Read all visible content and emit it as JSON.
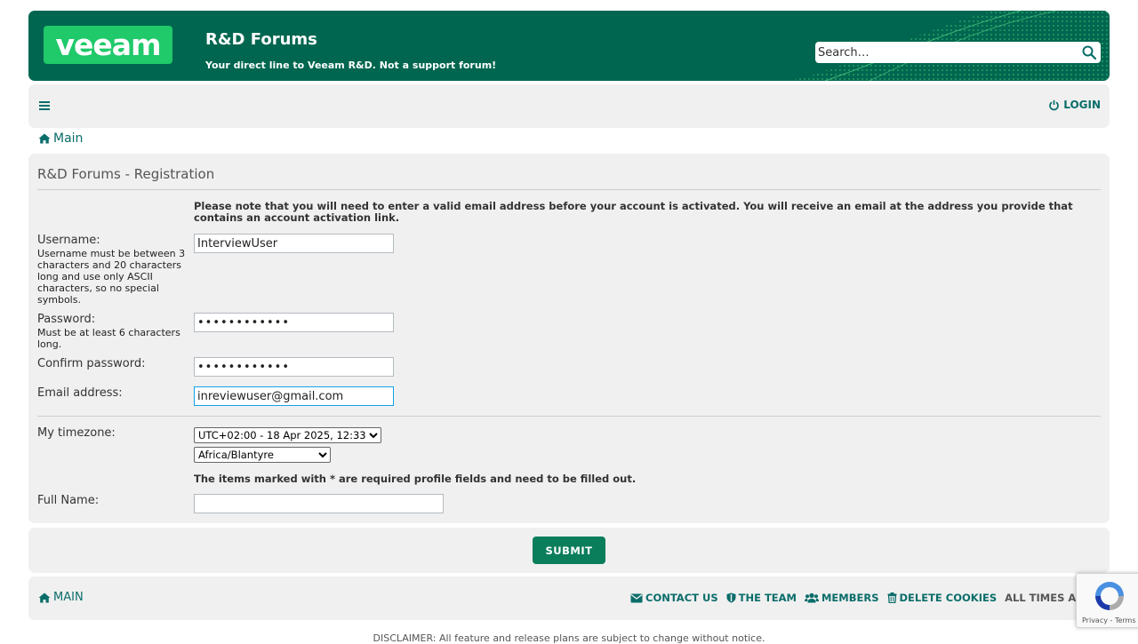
{
  "header": {
    "logo_text": "veeam",
    "site_title": "R&D Forums",
    "site_description": "Your direct line to Veeam R&D. Not a support forum!",
    "search_placeholder": "Search…",
    "search_icon": "search-icon",
    "brand_color": "#00664f",
    "logo_color": "#20c96a"
  },
  "navbar": {
    "menu_icon": "hamburger-icon",
    "login_label": "LOGIN",
    "login_icon": "power-icon"
  },
  "breadcrumb": {
    "home_label": "Main",
    "home_icon": "home-icon"
  },
  "registration": {
    "title": "R&D Forums - Registration",
    "note": "Please note that you will need to enter a valid email address before your account is activated. You will receive an email at the address you provide that contains an account activation link.",
    "fields": {
      "username": {
        "label": "Username:",
        "explain": "Username must be between 3 characters and 20 characters long and use only ASCII characters, so no special symbols.",
        "value": "InterviewUser"
      },
      "password": {
        "label": "Password:",
        "explain": "Must be at least 6 characters long.",
        "value": "••••••••••••"
      },
      "confirm_password": {
        "label": "Confirm password:",
        "value": "••••••••••••"
      },
      "email": {
        "label": "Email address:",
        "value": "inreviewuser@gmail.com"
      },
      "timezone": {
        "label": "My timezone:",
        "offset_selected": "UTC+02:00 - 18 Apr 2025, 12:33",
        "zone_selected": "Africa/Blantyre"
      },
      "required_note": "The items marked with * are required profile fields and need to be filled out.",
      "full_name": {
        "label": "Full Name:",
        "value": ""
      }
    },
    "submit_label": "SUBMIT",
    "submit_color": "#0a7d5b"
  },
  "footer": {
    "main_label": "MAIN",
    "links": [
      {
        "label": "CONTACT US",
        "icon": "envelope-icon"
      },
      {
        "label": "THE TEAM",
        "icon": "shield-icon"
      },
      {
        "label": "MEMBERS",
        "icon": "users-icon"
      },
      {
        "label": "DELETE COOKIES",
        "icon": "trash-icon"
      }
    ],
    "times_label": "ALL TIMES ARE",
    "disclaimer": "DISCLAIMER: All feature and release plans are subject to change without notice."
  },
  "recaptcha": {
    "privacy": "Privacy",
    "terms": "Terms",
    "separator": " - "
  }
}
